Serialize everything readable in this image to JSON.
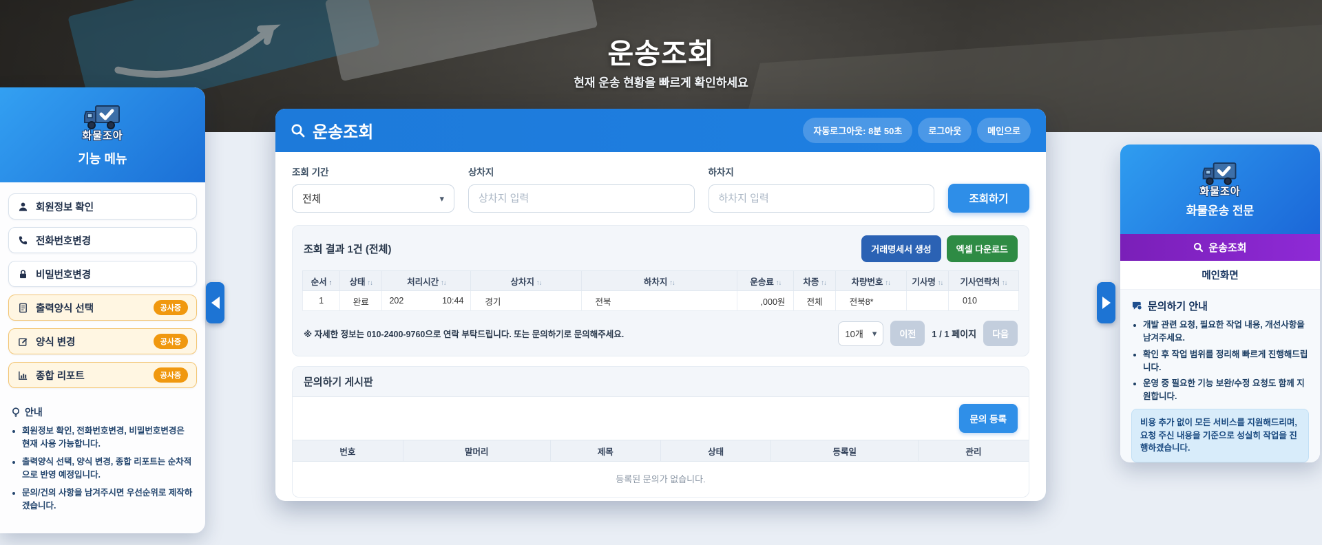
{
  "hero": {
    "title": "운송조회",
    "subtitle": "현재 운송 현황을 빠르게 확인하세요"
  },
  "icons": {
    "sort_both": "↑↓",
    "sort_active": "↑",
    "chevron_down": "▾"
  },
  "colors": {
    "accent_blue": "#1d7ada",
    "purple": "#8526c9",
    "green": "#2e8b44",
    "orange": "#f0980f",
    "navy_button": "#2b62b4"
  },
  "left_sidebar": {
    "logo_text": "화물조아",
    "menu_title": "기능 메뉴",
    "items": [
      {
        "label": "회원정보 확인",
        "badge": ""
      },
      {
        "label": "전화번호변경",
        "badge": ""
      },
      {
        "label": "비밀번호변경",
        "badge": ""
      },
      {
        "label": "출력양식 선택",
        "badge": "공사중"
      },
      {
        "label": "양식 변경",
        "badge": "공사중"
      },
      {
        "label": "종합 리포트",
        "badge": "공사중"
      }
    ],
    "notice": {
      "title": "안내",
      "bullets": [
        "회원정보 확인, 전화번호변경, 비밀번호변경은 현재 사용 가능합니다.",
        "출력양식 선택, 양식 변경, 종합 리포트는 순차적으로 반영 예정입니다.",
        "문의/건의 사항을 남겨주시면 우선순위로 제작하겠습니다."
      ]
    }
  },
  "main": {
    "header": {
      "title": "운송조회",
      "auto_logout": "자동로그아웃: 8분 50초",
      "logout": "로그아웃",
      "to_main": "메인으로"
    },
    "form": {
      "period_label": "조회 기간",
      "period_value": "전체",
      "origin_label": "상차지",
      "origin_placeholder": "상차지 입력",
      "dest_label": "하차지",
      "dest_placeholder": "하차지 입력",
      "search_button": "조회하기"
    },
    "results": {
      "summary": "조회 결과 1건 (전체)",
      "statement_button": "거래명세서 생성",
      "excel_button": "엑셀 다운로드",
      "columns": [
        "순서",
        "상태",
        "처리시간",
        "상차지",
        "하차지",
        "운송료",
        "차종",
        "차량번호",
        "기사명",
        "기사연락처"
      ],
      "row": {
        "seq": "1",
        "status": "완료",
        "time1": "202",
        "time2": "10:44",
        "origin": "경기",
        "dest": "전북",
        "fee": ",000원",
        "car_type": "전체",
        "car_no": "전북8*",
        "driver": "",
        "contact": "010"
      },
      "note": "※ 자세한 정보는 010-2400-9760으로 연락 부탁드립니다. 또는 문의하기로 문의해주세요.",
      "page_size": "10개",
      "prev_button": "이전",
      "page_info": "1 / 1 페이지",
      "next_button": "다음"
    },
    "board": {
      "title": "문의하기 게시판",
      "register_button": "문의 등록",
      "columns": [
        "번호",
        "말머리",
        "제목",
        "상태",
        "등록일",
        "관리"
      ],
      "empty_text": "등록된 문의가 없습니다."
    }
  },
  "right_sidebar": {
    "logo_text": "화물조아",
    "subtitle": "화물운송 전문",
    "active_item": "운송조회",
    "main_link": "메인화면",
    "inquiry": {
      "title": "문의하기 안내",
      "bullets": [
        "개발 관련 요청, 필요한 작업 내용, 개선사항을 남겨주세요.",
        "확인 후 작업 범위를 정리해 빠르게 진행해드립니다.",
        "운영 중 필요한 기능 보완/수정 요청도 함께 지원합니다."
      ],
      "highlight": "비용 추가 없이 모든 서비스를 지원해드리며, 요청 주신 내용을 기준으로 성실히 작업을 진행하겠습니다."
    }
  }
}
